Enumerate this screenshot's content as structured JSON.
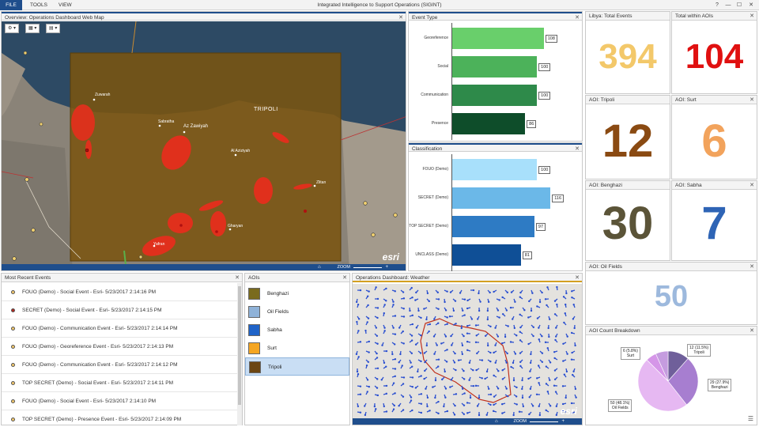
{
  "app": {
    "title": "Integrated Intelligence to Support Operations (SIGINT)",
    "menu": [
      "FILE",
      "TOOLS",
      "VIEW"
    ],
    "window_controls": [
      "?",
      "—",
      "☐",
      "✕"
    ]
  },
  "map": {
    "title": "Overview: Operations Dashboard Web Map",
    "zoom_label": "ZOOM",
    "attribution": "esri",
    "places": [
      "Zuwarah",
      "Sabratha",
      "Az Zawiyah",
      "TRIPOLI",
      "Al Aziziyah",
      "Zlitan",
      "Gharyan",
      "Yafran"
    ]
  },
  "event_type": {
    "title": "Event Type",
    "categories": [
      "Georeference",
      "Social",
      "Communication",
      "Presence"
    ],
    "values": [
      108,
      100,
      100,
      86
    ],
    "colors": [
      "#69cf6b",
      "#4cb25a",
      "#2e8a4a",
      "#0e4d2a"
    ]
  },
  "classification": {
    "title": "Classification",
    "categories": [
      "FOUO (Demo)",
      "SECRET (Demo)",
      "TOP SECRET (Demo)",
      "UNCLASS (Demo)"
    ],
    "values": [
      100,
      116,
      97,
      81
    ],
    "colors": [
      "#a8e0fb",
      "#6bb8e8",
      "#2e7bc4",
      "#0f4f96"
    ]
  },
  "kpis": {
    "libya_total": {
      "title": "Libya: Total Events",
      "value": "394",
      "color": "#f3c86a"
    },
    "total_aois": {
      "title": "Total within AOIs",
      "value": "104",
      "color": "#e01010"
    },
    "tripoli": {
      "title": "AOI: Tripoli",
      "value": "12",
      "color": "#8a4a12"
    },
    "surt": {
      "title": "AOI: Surt",
      "value": "6",
      "color": "#f2a35c"
    },
    "benghazi": {
      "title": "AOI: Benghazi",
      "value": "30",
      "color": "#5b5438"
    },
    "sabha": {
      "title": "AOI: Sabha",
      "value": "7",
      "color": "#2e64b5"
    },
    "oil_fields": {
      "title": "AOI: Oil Fields",
      "value": "50",
      "color": "#9db9dd"
    }
  },
  "events": {
    "title": "Most Recent Events",
    "rows": [
      {
        "text": "FOUO (Demo) - Social Event - Esri- 5/23/2017 2:14:16 PM",
        "dot": "yellow"
      },
      {
        "text": "SECRET (Demo) - Social Event - Esri- 5/23/2017 2:14:15 PM",
        "dot": "red"
      },
      {
        "text": "FOUO (Demo) - Communication Event - Esri- 5/23/2017 2:14:14 PM",
        "dot": "yellow"
      },
      {
        "text": "FOUO (Demo) - Georeference Event - Esri- 5/23/2017 2:14:13 PM",
        "dot": "yellow"
      },
      {
        "text": "FOUO (Demo) - Communication Event - Esri- 5/23/2017 2:14:12 PM",
        "dot": "yellow"
      },
      {
        "text": "TOP SECRET (Demo) - Social Event - Esri- 5/23/2017 2:14:11 PM",
        "dot": "yellow"
      },
      {
        "text": "FOUO (Demo) - Social Event - Esri- 5/23/2017 2:14:10 PM",
        "dot": "yellow"
      },
      {
        "text": "TOP SECRET (Demo) - Presence Event - Esri- 5/23/2017 2:14:09 PM",
        "dot": "yellow"
      }
    ]
  },
  "aois": {
    "title": "AOIs",
    "items": [
      {
        "label": "Benghazi",
        "color": "#7a6b1e"
      },
      {
        "label": "Oil Fields",
        "color": "#8fb2d8"
      },
      {
        "label": "Sabha",
        "color": "#1f63c8"
      },
      {
        "label": "Surt",
        "color": "#f5a623"
      },
      {
        "label": "Tripoli",
        "color": "#6b4512"
      }
    ]
  },
  "weather": {
    "title": "Operations Dashboard: Weather",
    "zoom_label": "ZOOM",
    "attribution": "esri"
  },
  "aoi_breakdown": {
    "title": "AOI Count Breakdown",
    "chart_data": {
      "type": "pie",
      "slices": [
        {
          "name": "Tripoli",
          "label": "12 (11.5%)",
          "value": 12,
          "color": "#6f5f9a"
        },
        {
          "name": "Benghazi",
          "label": "29 (27.9%)",
          "value": 29,
          "color": "#a77ed0"
        },
        {
          "name": "Oil Fields",
          "label": "50 (48.1%)",
          "value": 50,
          "color": "#e6b8f2"
        },
        {
          "name": "Surt",
          "label": "6 (5.8%)",
          "value": 6,
          "color": "#d596e8"
        },
        {
          "name": "Sabha",
          "label": "",
          "value": 7,
          "color": "#c59cdf"
        }
      ]
    }
  }
}
